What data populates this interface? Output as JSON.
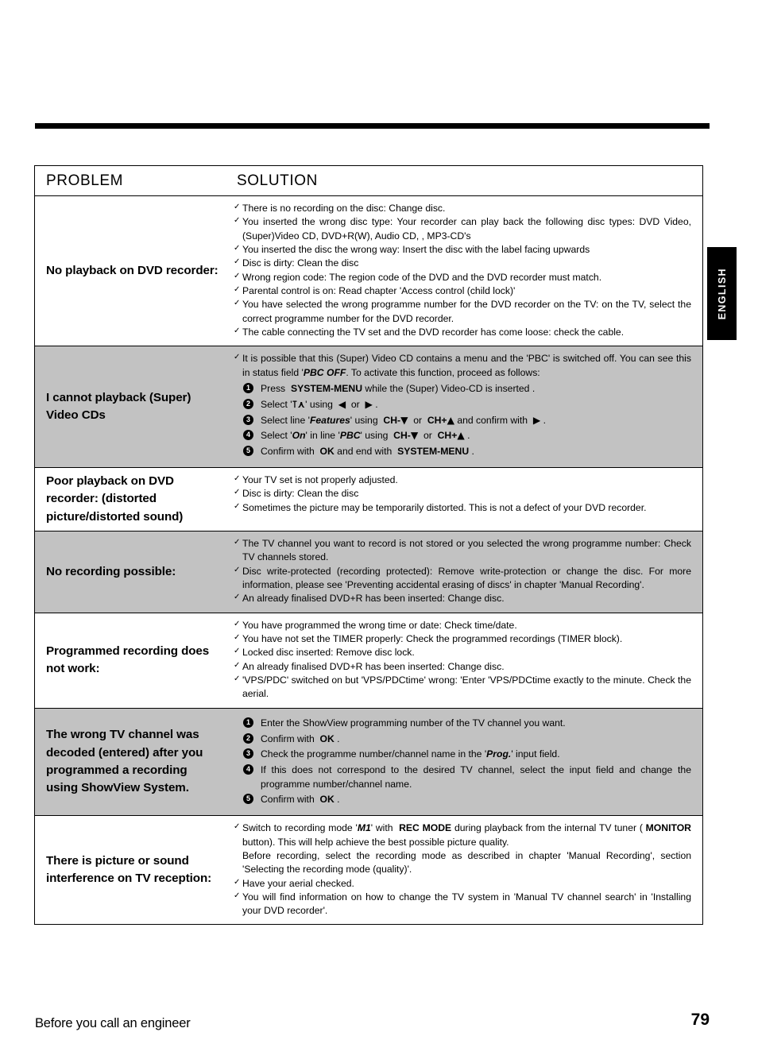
{
  "page": {
    "language_tab": "ENGLISH",
    "footer_title": "Before you call an engineer",
    "page_number": "79"
  },
  "table": {
    "headers": {
      "problem": "PROBLEM",
      "solution": "SOLUTION"
    },
    "rows": [
      {
        "problem": "No playback on DVD recorder:",
        "shaded": false,
        "items": [
          "There is no recording on the disc: Change disc.",
          "You inserted the wrong disc type: Your recorder can play back the following disc types: DVD Video, (Super)Video CD, DVD+R(W), Audio CD, , MP3-CD's",
          "You inserted the disc the wrong way: Insert the disc with the label facing upwards",
          "Disc is dirty: Clean the disc",
          "Wrong region code: The region code of the DVD and the DVD recorder must match.",
          "Parental control is on: Read chapter 'Access control (child lock)'",
          "You have selected the wrong programme number for the DVD recorder on the TV: on the TV, select the correct programme number for the DVD recorder.",
          "The cable connecting the TV set and the DVD recorder has come loose: check the cable."
        ]
      },
      {
        "problem": "I cannot playback (Super) Video CDs",
        "shaded": true,
        "intro": "It is possible that this (Super) Video CD contains a menu and the 'PBC' is switched off. You can see this in status field 'PBC OFF'. To activate this function, proceed as follows:",
        "intro_emph": "PBC OFF",
        "steps": [
          "Press  SYSTEM-MENU while the (Super) Video-CD is inserted .",
          "Select 'icon' using  ◀  or  ▶ .",
          "Select line 'Features' using  CH-▼  or  CH+▲ and confirm with  ▶ .",
          "Select 'On' in line 'PBC' using  CH-▼  or  CH+▲ .",
          "Confirm with  OK and end with  SYSTEM-MENU ."
        ]
      },
      {
        "problem": "Poor playback on DVD recorder: (distorted picture/distorted sound)",
        "shaded": false,
        "items": [
          "Your TV set is not properly adjusted.",
          "Disc is dirty: Clean the disc",
          "Sometimes the picture may be temporarily distorted. This is not a defect of your DVD recorder."
        ]
      },
      {
        "problem": "No recording possible:",
        "shaded": true,
        "items": [
          "The TV channel you want to record is not stored or you selected the wrong programme number: Check TV channels stored.",
          "Disc write-protected (recording protected): Remove write-protection or change the disc. For more information, please see 'Preventing accidental erasing of discs' in chapter 'Manual Recording'.",
          "An already finalised DVD+R has been inserted: Change disc."
        ]
      },
      {
        "problem": "Programmed recording does not work:",
        "shaded": false,
        "items": [
          "You have programmed the wrong time or date: Check time/date.",
          "You have not set the TIMER properly: Check the programmed recordings (TIMER block).",
          "Locked disc inserted: Remove disc lock.",
          "An already finalised DVD+R has been inserted: Change disc.",
          "'VPS/PDC' switched on but 'VPS/PDCtime' wrong: 'Enter 'VPS/PDCtime exactly to the minute. Check the aerial."
        ]
      },
      {
        "problem": "The wrong TV channel was decoded (entered) after you programmed a recording using ShowView System.",
        "shaded": true,
        "steps": [
          "Enter the ShowView programming number of the TV channel you want.",
          "Confirm with  OK .",
          "Check the programme number/channel name in the 'Prog.' input field.",
          "If this does not correspond to the desired TV channel, select the input field and change the programme number/channel name.",
          "Confirm with  OK ."
        ]
      },
      {
        "problem": "There is picture or sound interference on TV reception:",
        "shaded": false,
        "items": [
          "Switch to recording mode 'M1' with  REC MODE during playback from the internal TV tuner ( MONITOR button). This will help achieve the best possible picture quality.",
          "Before recording, select the recording mode as described in chapter 'Manual Recording', section 'Selecting the recording mode (quality)'.",
          "Have your aerial checked.",
          "You will find information on how to change the TV system in 'Manual TV channel search' in 'Installing your DVD recorder'."
        ]
      }
    ]
  }
}
